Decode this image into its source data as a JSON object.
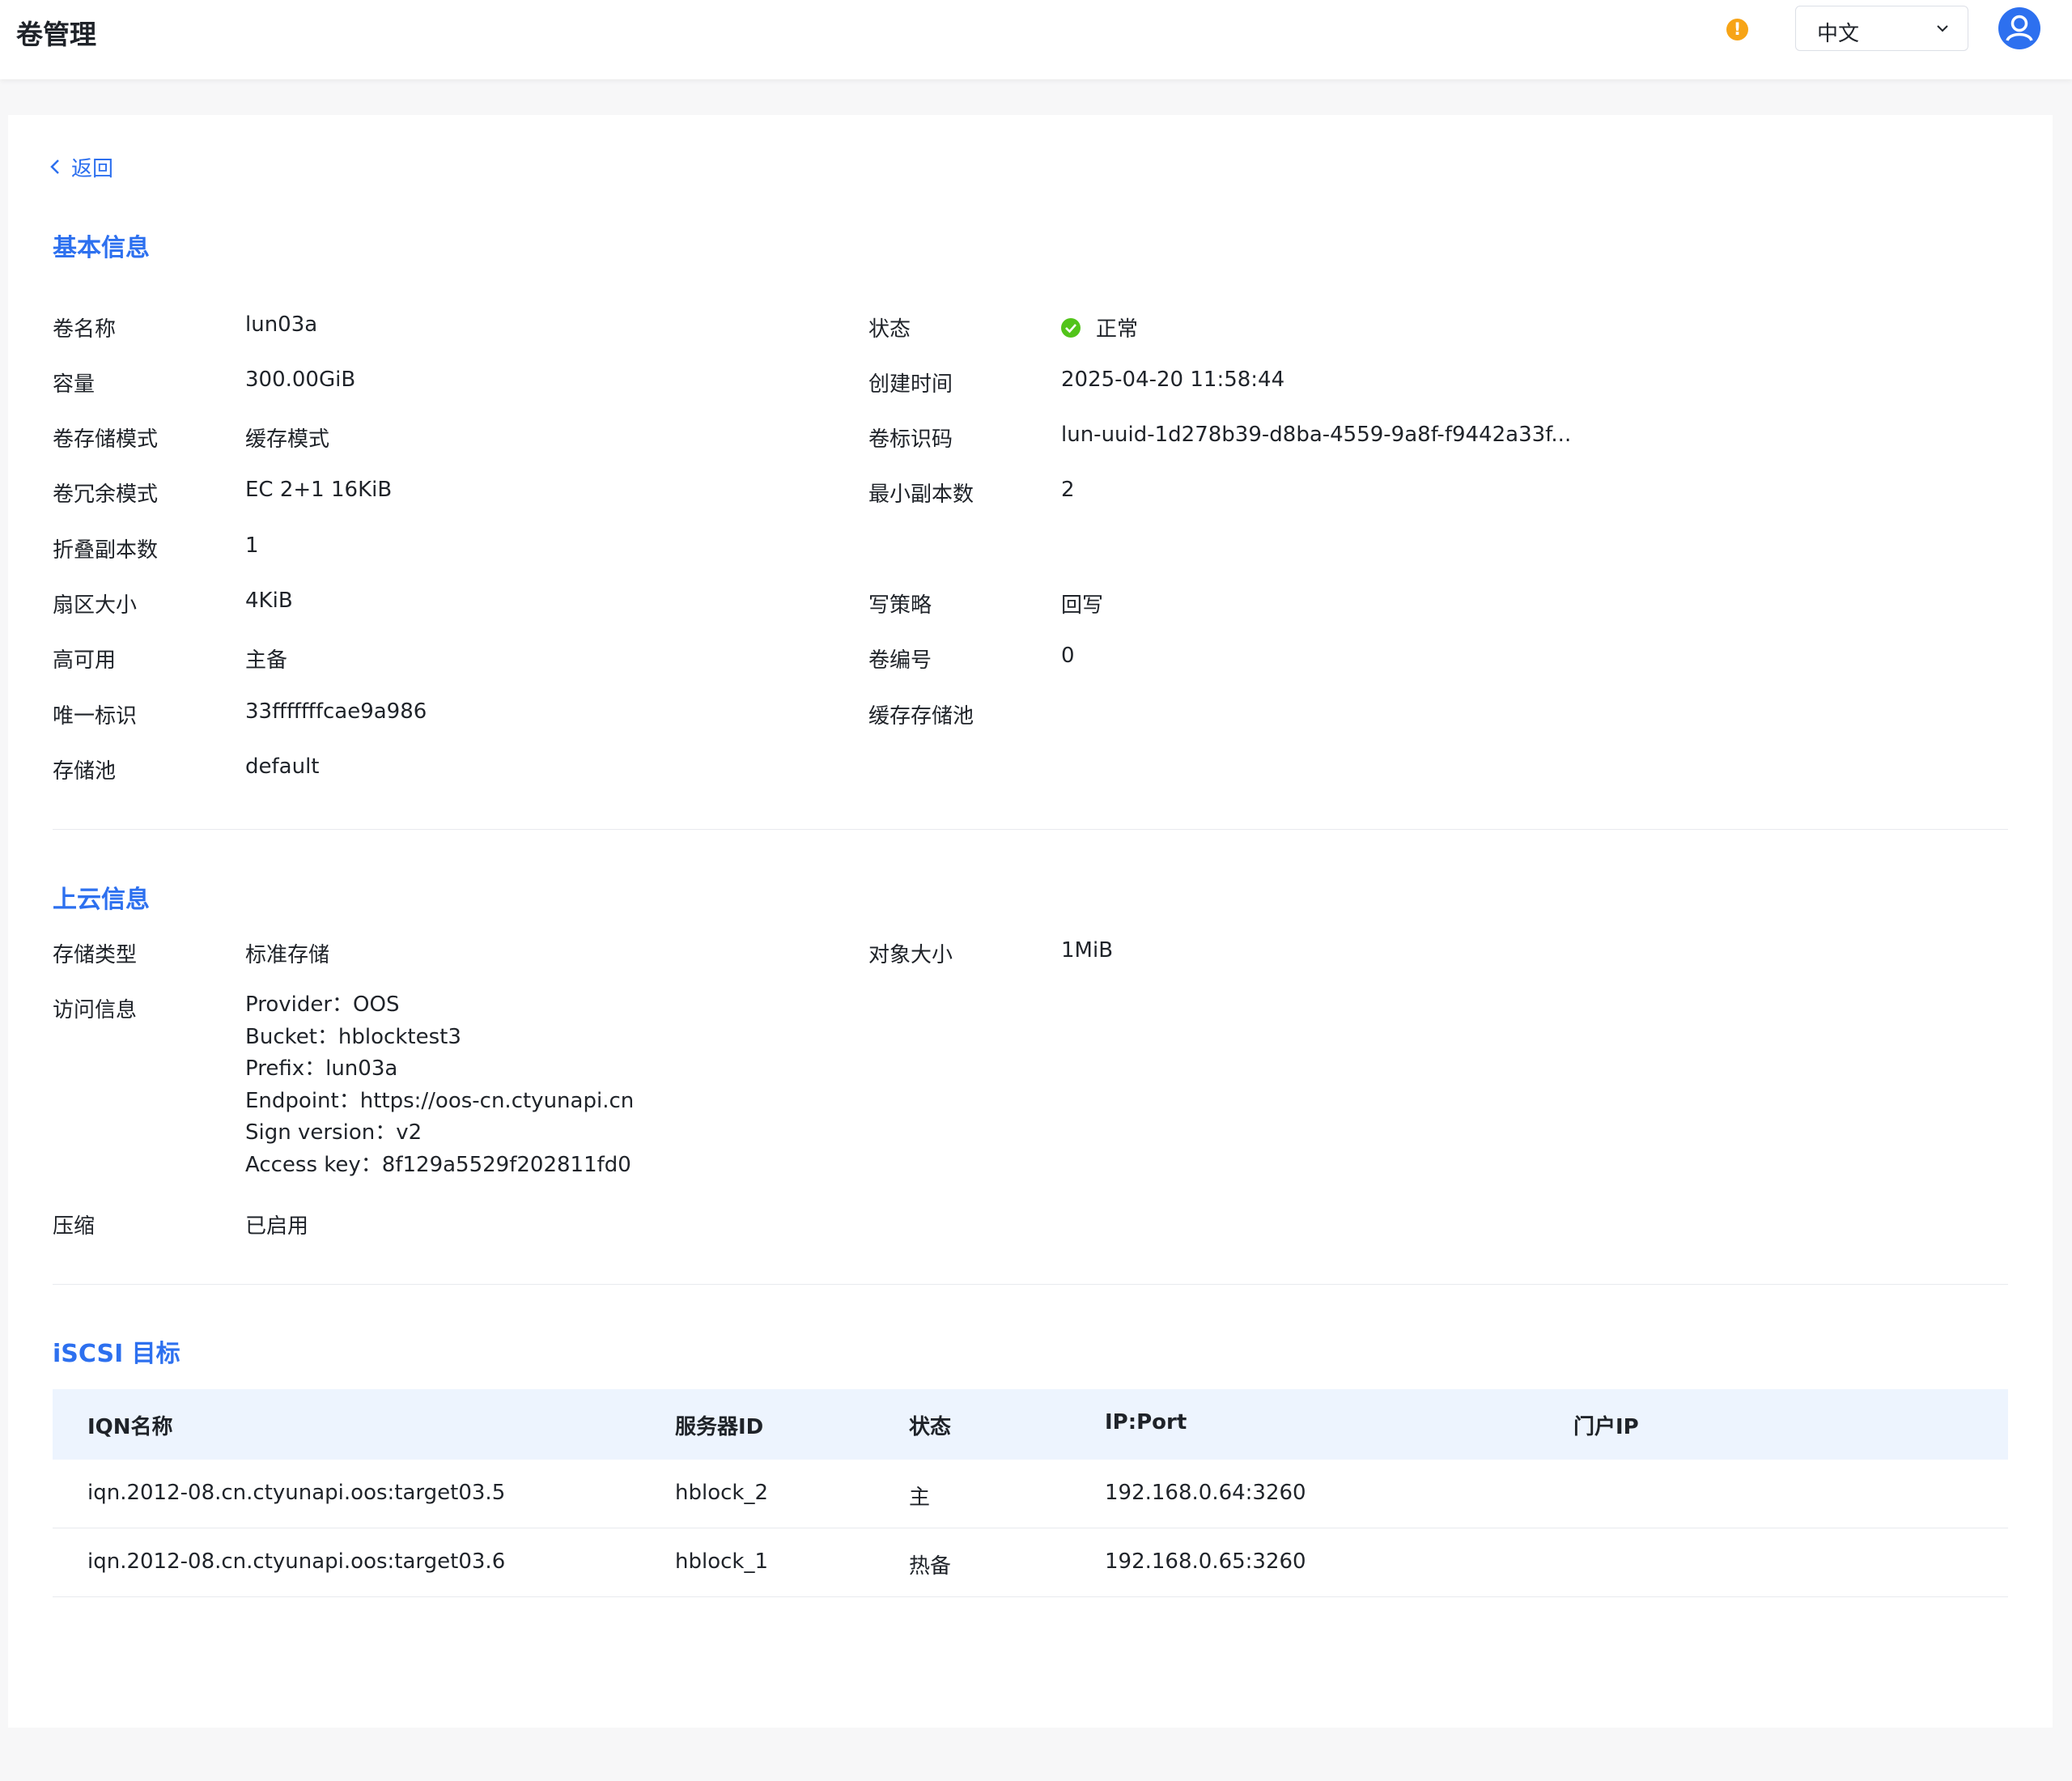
{
  "header": {
    "title": "卷管理",
    "alert_glyph": "!",
    "language": "中文",
    "icons": {
      "alert": "alert-icon",
      "chevron": "chevron-down-icon",
      "avatar": "user-avatar-icon"
    },
    "colors": {
      "alert": "#f7a416",
      "accent": "#2d70ef"
    }
  },
  "back_label": "返回",
  "basic": {
    "title": "基本信息",
    "left": [
      {
        "label": "卷名称",
        "value": "lun03a"
      },
      {
        "label": "容量",
        "value": "300.00GiB"
      },
      {
        "label": "卷存储模式",
        "value": "缓存模式"
      },
      {
        "label": "卷冗余模式",
        "value": "EC 2+1 16KiB"
      },
      {
        "label": "折叠副本数",
        "value": "1"
      },
      {
        "label": "扇区大小",
        "value": "4KiB"
      },
      {
        "label": "高可用",
        "value": "主备"
      },
      {
        "label": "唯一标识",
        "value": "33fffffffcae9a986"
      },
      {
        "label": "存储池",
        "value": "default"
      }
    ],
    "right": [
      {
        "label": "状态",
        "value": "正常"
      },
      {
        "label": "创建时间",
        "value": "2025-04-20 11:58:44"
      },
      {
        "label": "卷标识码",
        "value": "lun-uuid-1d278b39-d8ba-4559-9a8f-f9442a33f..."
      },
      {
        "label": "最小副本数",
        "value": "2"
      },
      {
        "label": "写策略",
        "value": "回写"
      },
      {
        "label": "卷编号",
        "value": "0"
      },
      {
        "label": "缓存存储池",
        "value": ""
      }
    ],
    "status_color": "#52c41a"
  },
  "cloud": {
    "title": "上云信息",
    "storage_type_label": "存储类型",
    "storage_type": "标准存储",
    "object_size_label": "对象大小",
    "object_size": "1MiB",
    "access_label": "访问信息",
    "access": [
      "Provider：OOS",
      "Bucket：hblocktest3",
      "Prefix：lun03a",
      "Endpoint：https://oos-cn.ctyunapi.cn",
      "Sign version：v2",
      "Access key：8f129a5529f202811fd0"
    ],
    "compress_label": "压缩",
    "compress": "已启用"
  },
  "iscsi": {
    "title": "iSCSI 目标",
    "columns": [
      "IQN名称",
      "服务器ID",
      "状态",
      "IP:Port",
      "门户IP"
    ],
    "rows": [
      [
        "iqn.2012-08.cn.ctyunapi.oos:target03.5",
        "hblock_2",
        "主",
        "192.168.0.64:3260",
        ""
      ],
      [
        "iqn.2012-08.cn.ctyunapi.oos:target03.6",
        "hblock_1",
        "热备",
        "192.168.0.65:3260",
        ""
      ]
    ]
  }
}
